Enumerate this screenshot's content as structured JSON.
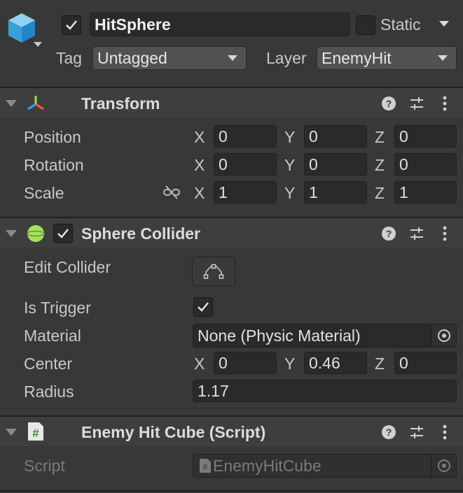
{
  "gameobject": {
    "active": true,
    "name": "HitSphere",
    "static_label": "Static",
    "static_checked": false,
    "tag_label": "Tag",
    "tag_value": "Untagged",
    "layer_label": "Layer",
    "layer_value": "EnemyHit"
  },
  "transform": {
    "title": "Transform",
    "position": {
      "label": "Position",
      "x": "0",
      "y": "0",
      "z": "0"
    },
    "rotation": {
      "label": "Rotation",
      "x": "0",
      "y": "0",
      "z": "0"
    },
    "scale": {
      "label": "Scale",
      "x": "1",
      "y": "1",
      "z": "1"
    }
  },
  "sphere_collider": {
    "title": "Sphere Collider",
    "enabled": true,
    "edit_collider_label": "Edit Collider",
    "is_trigger_label": "Is Trigger",
    "is_trigger": true,
    "material_label": "Material",
    "material_value": "None (Physic Material)",
    "center": {
      "label": "Center",
      "x": "0",
      "y": "0.46",
      "z": "0"
    },
    "radius_label": "Radius",
    "radius_value": "1.17"
  },
  "script_component": {
    "title": "Enemy Hit Cube (Script)",
    "script_label": "Script",
    "script_value": "EnemyHitCube"
  },
  "axes": {
    "x": "X",
    "y": "Y",
    "z": "Z"
  },
  "colors": {
    "background": "#383838",
    "field": "#2a2a2a",
    "collider_icon": "#a6e05a",
    "script_icon": "#5fb34f"
  },
  "icons": [
    "gameobject-cube-icon",
    "transform-axes-icon",
    "sphere-collider-icon",
    "script-icon",
    "help-icon",
    "preset-icon",
    "kebab-menu-icon",
    "unlink-icon",
    "edit-collider-icon",
    "object-picker-icon"
  ]
}
